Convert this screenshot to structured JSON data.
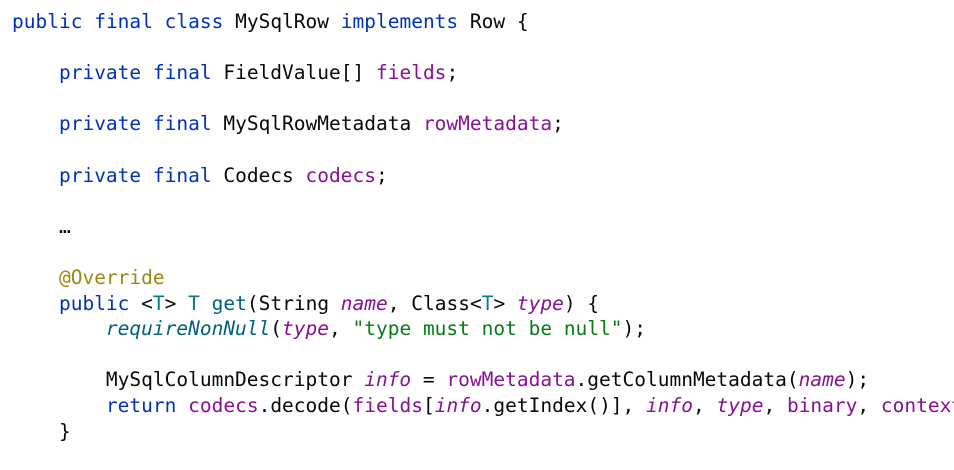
{
  "lines": [
    [
      {
        "t": "public",
        "c": "kw"
      },
      {
        "t": " "
      },
      {
        "t": "final",
        "c": "kw"
      },
      {
        "t": " "
      },
      {
        "t": "class",
        "c": "kw"
      },
      {
        "t": " MySqlRow "
      },
      {
        "t": "implements",
        "c": "kw"
      },
      {
        "t": " Row {"
      }
    ],
    [],
    [
      {
        "t": "    "
      },
      {
        "t": "private",
        "c": "kw"
      },
      {
        "t": " "
      },
      {
        "t": "final",
        "c": "kw"
      },
      {
        "t": " FieldValue[] "
      },
      {
        "t": "fields",
        "c": "fld"
      },
      {
        "t": ";"
      }
    ],
    [],
    [
      {
        "t": "    "
      },
      {
        "t": "private",
        "c": "kw"
      },
      {
        "t": " "
      },
      {
        "t": "final",
        "c": "kw"
      },
      {
        "t": " MySqlRowMetadata "
      },
      {
        "t": "rowMetadata",
        "c": "fld"
      },
      {
        "t": ";"
      }
    ],
    [],
    [
      {
        "t": "    "
      },
      {
        "t": "private",
        "c": "kw"
      },
      {
        "t": " "
      },
      {
        "t": "final",
        "c": "kw"
      },
      {
        "t": " Codecs "
      },
      {
        "t": "codecs",
        "c": "fld"
      },
      {
        "t": ";"
      }
    ],
    [],
    [
      {
        "t": "    …"
      }
    ],
    [],
    [
      {
        "t": "    "
      },
      {
        "t": "@Override",
        "c": "ann"
      }
    ],
    [
      {
        "t": "    "
      },
      {
        "t": "public",
        "c": "kw"
      },
      {
        "t": " <"
      },
      {
        "t": "T",
        "c": "tp"
      },
      {
        "t": "> "
      },
      {
        "t": "T",
        "c": "tp"
      },
      {
        "t": " "
      },
      {
        "t": "get",
        "c": "fn"
      },
      {
        "t": "(String "
      },
      {
        "t": "name",
        "c": "par"
      },
      {
        "t": ", Class<"
      },
      {
        "t": "T",
        "c": "tp"
      },
      {
        "t": "> "
      },
      {
        "t": "type",
        "c": "par"
      },
      {
        "t": ") {"
      }
    ],
    [
      {
        "t": "        "
      },
      {
        "t": "requireNonNull",
        "c": "st"
      },
      {
        "t": "("
      },
      {
        "t": "type",
        "c": "par"
      },
      {
        "t": ", "
      },
      {
        "t": "\"type must not be null\"",
        "c": "str"
      },
      {
        "t": ");"
      }
    ],
    [],
    [
      {
        "t": "        MySqlColumnDescriptor "
      },
      {
        "t": "info",
        "c": "lv"
      },
      {
        "t": " = "
      },
      {
        "t": "rowMetadata",
        "c": "fld"
      },
      {
        "t": ".getColumnMetadata("
      },
      {
        "t": "name",
        "c": "par"
      },
      {
        "t": ");"
      }
    ],
    [
      {
        "t": "        "
      },
      {
        "t": "return",
        "c": "kw"
      },
      {
        "t": " "
      },
      {
        "t": "codecs",
        "c": "fld"
      },
      {
        "t": ".decode("
      },
      {
        "t": "fields",
        "c": "fld"
      },
      {
        "t": "["
      },
      {
        "t": "info",
        "c": "lv"
      },
      {
        "t": ".getIndex()], "
      },
      {
        "t": "info",
        "c": "lv"
      },
      {
        "t": ", "
      },
      {
        "t": "type",
        "c": "par"
      },
      {
        "t": ", "
      },
      {
        "t": "binary",
        "c": "fld"
      },
      {
        "t": ", "
      },
      {
        "t": "context",
        "c": "fld"
      },
      {
        "t": ");"
      }
    ],
    [
      {
        "t": "    }"
      }
    ]
  ]
}
